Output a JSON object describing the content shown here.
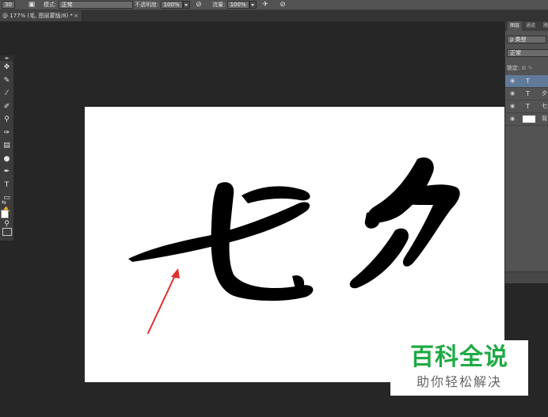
{
  "options_bar": {
    "size_value": "30",
    "mode_label": "模式:",
    "mode_value": "正常",
    "opacity_label": "不透明度:",
    "opacity_value": "100%",
    "flow_label": "流量:",
    "flow_value": "100%"
  },
  "document": {
    "tab_title": "@ 177% (毛, 图层蒙版/8) *",
    "close_glyph": "×"
  },
  "toolbox": {
    "tools": [
      {
        "name": "move-tool-icon",
        "glyph": "✥"
      },
      {
        "name": "quick-selection-tool-icon",
        "glyph": "✎"
      },
      {
        "name": "eyedropper-tool-icon",
        "glyph": "⁄"
      },
      {
        "name": "brush-tool-icon",
        "glyph": "✐"
      },
      {
        "name": "clone-stamp-tool-icon",
        "glyph": "⚲"
      },
      {
        "name": "history-brush-tool-icon",
        "glyph": "✑"
      },
      {
        "name": "gradient-tool-icon",
        "glyph": "▤"
      },
      {
        "name": "dodge-tool-icon",
        "glyph": "●"
      },
      {
        "name": "pen-tool-icon",
        "glyph": "✒"
      },
      {
        "name": "type-tool-icon",
        "glyph": "T"
      },
      {
        "name": "rectangle-tool-icon",
        "glyph": "▭"
      },
      {
        "name": "hand-tool-icon",
        "glyph": "✋"
      },
      {
        "name": "zoom-tool-icon",
        "glyph": "⚲"
      }
    ]
  },
  "layers_panel": {
    "tab_layers": "图层",
    "tab_channels": "通道",
    "tab_paths": "路",
    "filter_label": "ρ 类型",
    "blend_mode": "正常",
    "lock_label": "锁定:",
    "layers": [
      {
        "type": "T",
        "name": "",
        "selected": true
      },
      {
        "type": "T",
        "name": "夕",
        "selected": false
      },
      {
        "type": "T",
        "name": "七",
        "selected": false
      },
      {
        "type": "thumb",
        "name": "背",
        "selected": false
      }
    ]
  },
  "canvas": {
    "background": "#ffffff",
    "ink": "#000000",
    "arrow_color": "#e0302e"
  },
  "watermark": {
    "line1": "百科全说",
    "line2": "助你轻松解决",
    "line1_color": "#1eaa45"
  }
}
